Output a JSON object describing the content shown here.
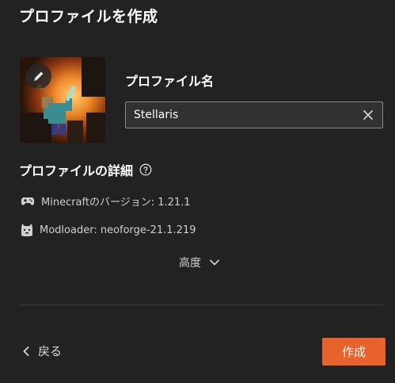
{
  "header": {
    "title": "プロファイルを作成"
  },
  "profile": {
    "name_label": "プロファイル名",
    "name_value": "Stellaris",
    "edit_icon": "pencil-icon",
    "clear_icon": "close-icon"
  },
  "details": {
    "heading": "プロファイルの詳細",
    "help_icon": "question-circle-icon",
    "minecraft_version": "Minecraftのバージョン: 1.21.1",
    "modloader": "Modloader: neoforge-21.1.219",
    "advanced_label": "高度"
  },
  "footer": {
    "back_label": "戻る",
    "create_label": "作成"
  },
  "colors": {
    "background": "#222222",
    "accent": "#e8622c",
    "field_border": "#8a8a8a"
  }
}
